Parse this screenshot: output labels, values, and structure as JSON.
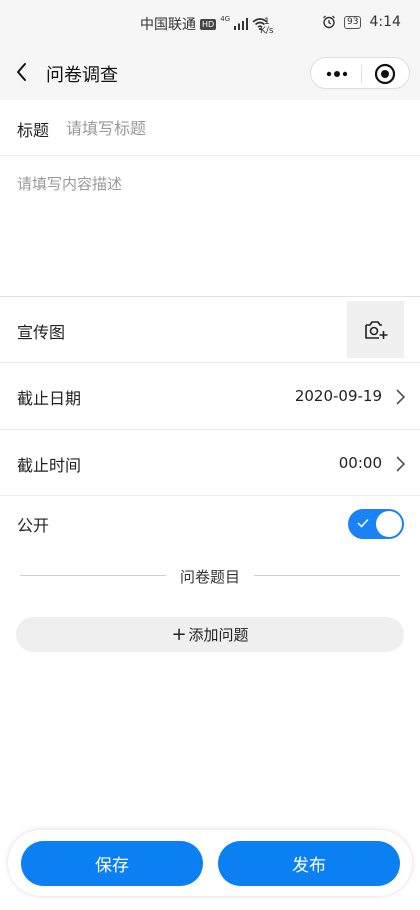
{
  "status_bar": {
    "carrier": "中国联通",
    "hd": "HD",
    "network": "4G",
    "net_speed_value": "1",
    "net_speed_unit": "K/s",
    "battery": "93",
    "time": "4:14"
  },
  "nav": {
    "title": "问卷调查"
  },
  "form": {
    "title_label": "标题",
    "title_placeholder": "请填写标题",
    "title_value": "",
    "desc_placeholder": "请填写内容描述",
    "banner_label": "宣传图",
    "deadline_date_label": "截止日期",
    "deadline_date_value": "2020-09-19",
    "deadline_time_label": "截止时间",
    "deadline_time_value": "00:00",
    "public_label": "公开",
    "public_on": true
  },
  "questions": {
    "section_title": "问卷题目",
    "add_plus": "+",
    "add_label": "添加问题"
  },
  "actions": {
    "save_label": "保存",
    "publish_label": "发布"
  },
  "colors": {
    "primary": "#0a80f3",
    "toggle_on": "#1a82f5",
    "header_bg": "#f6f6f6"
  }
}
